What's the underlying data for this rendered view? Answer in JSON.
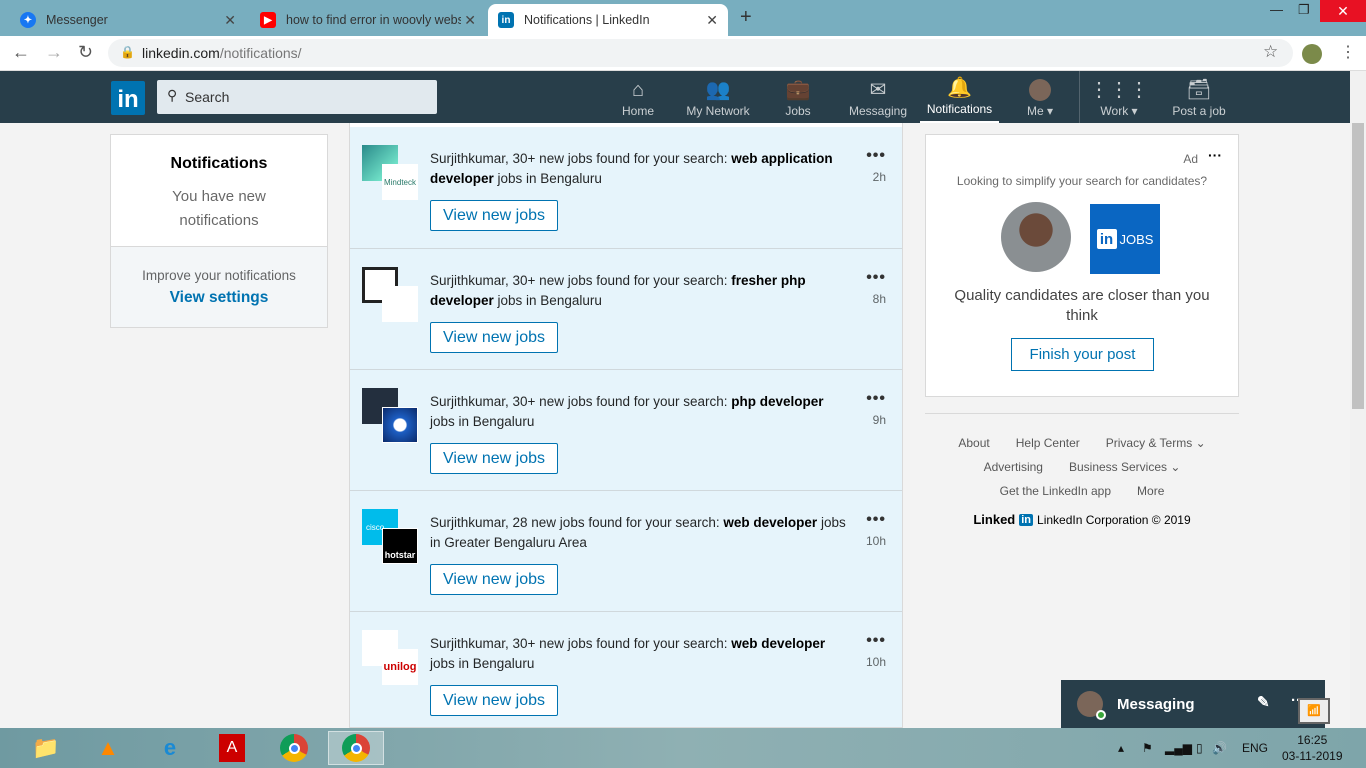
{
  "browser": {
    "tabs": [
      {
        "title": "Messenger"
      },
      {
        "title": "how to find error in woovly websi"
      },
      {
        "title": "Notifications | LinkedIn"
      }
    ],
    "url_host": "linkedin.com",
    "url_path": "/notifications/"
  },
  "nav": {
    "logo": "in",
    "search_placeholder": "Search",
    "items": [
      {
        "label": "Home"
      },
      {
        "label": "My Network"
      },
      {
        "label": "Jobs"
      },
      {
        "label": "Messaging"
      },
      {
        "label": "Notifications"
      },
      {
        "label": "Me"
      },
      {
        "label": "Work"
      },
      {
        "label": "Post a job"
      }
    ]
  },
  "left": {
    "title": "Notifications",
    "subtitle": "You have new notifications",
    "improve": "Improve your notifications",
    "settings_link": "View settings"
  },
  "notifications": [
    {
      "prefix": "Surjithkumar, 30+ new jobs found for your search: ",
      "query": "web application developer",
      "suffix": " jobs in Bengaluru",
      "time": "2h",
      "button": "View new jobs",
      "logo2": "Mindteck"
    },
    {
      "prefix": "Surjithkumar, 30+ new jobs found for your search: ",
      "query": "fresher php developer",
      "suffix": " jobs in Bengaluru",
      "time": "8h",
      "button": "View new jobs"
    },
    {
      "prefix": "Surjithkumar, 30+ new jobs found for your search: ",
      "query": "php developer",
      "suffix": " jobs in Bengaluru",
      "time": "9h",
      "button": "View new jobs"
    },
    {
      "prefix": "Surjithkumar, 28 new jobs found for your search: ",
      "query": "web developer",
      "suffix": " jobs in Greater Bengaluru Area",
      "time": "10h",
      "button": "View new jobs",
      "logo1": "cisco",
      "logo2": "hotstar"
    },
    {
      "prefix": "Surjithkumar, 30+ new jobs found for your search: ",
      "query": "web developer",
      "suffix": " jobs in Bengaluru",
      "time": "10h",
      "button": "View new jobs",
      "logo2": "unilog"
    }
  ],
  "ad": {
    "label": "Ad",
    "question": "Looking to simplify your search for candidates?",
    "jobs_logo": "JOBS",
    "headline": "Quality candidates are closer than you think",
    "cta": "Finish your post"
  },
  "footer": {
    "links": [
      "About",
      "Help Center",
      "Privacy & Terms",
      "Advertising",
      "Business Services",
      "Get the LinkedIn app",
      "More"
    ],
    "brand": "Linked",
    "copyright": "LinkedIn Corporation © 2019"
  },
  "messaging": {
    "label": "Messaging"
  },
  "taskbar": {
    "lang": "ENG",
    "time": "16:25",
    "date": "03-11-2019"
  },
  "colors": {
    "brand": "#0073b1",
    "nav_bg": "#283e4a",
    "unread_bg": "#e6f4fb"
  }
}
